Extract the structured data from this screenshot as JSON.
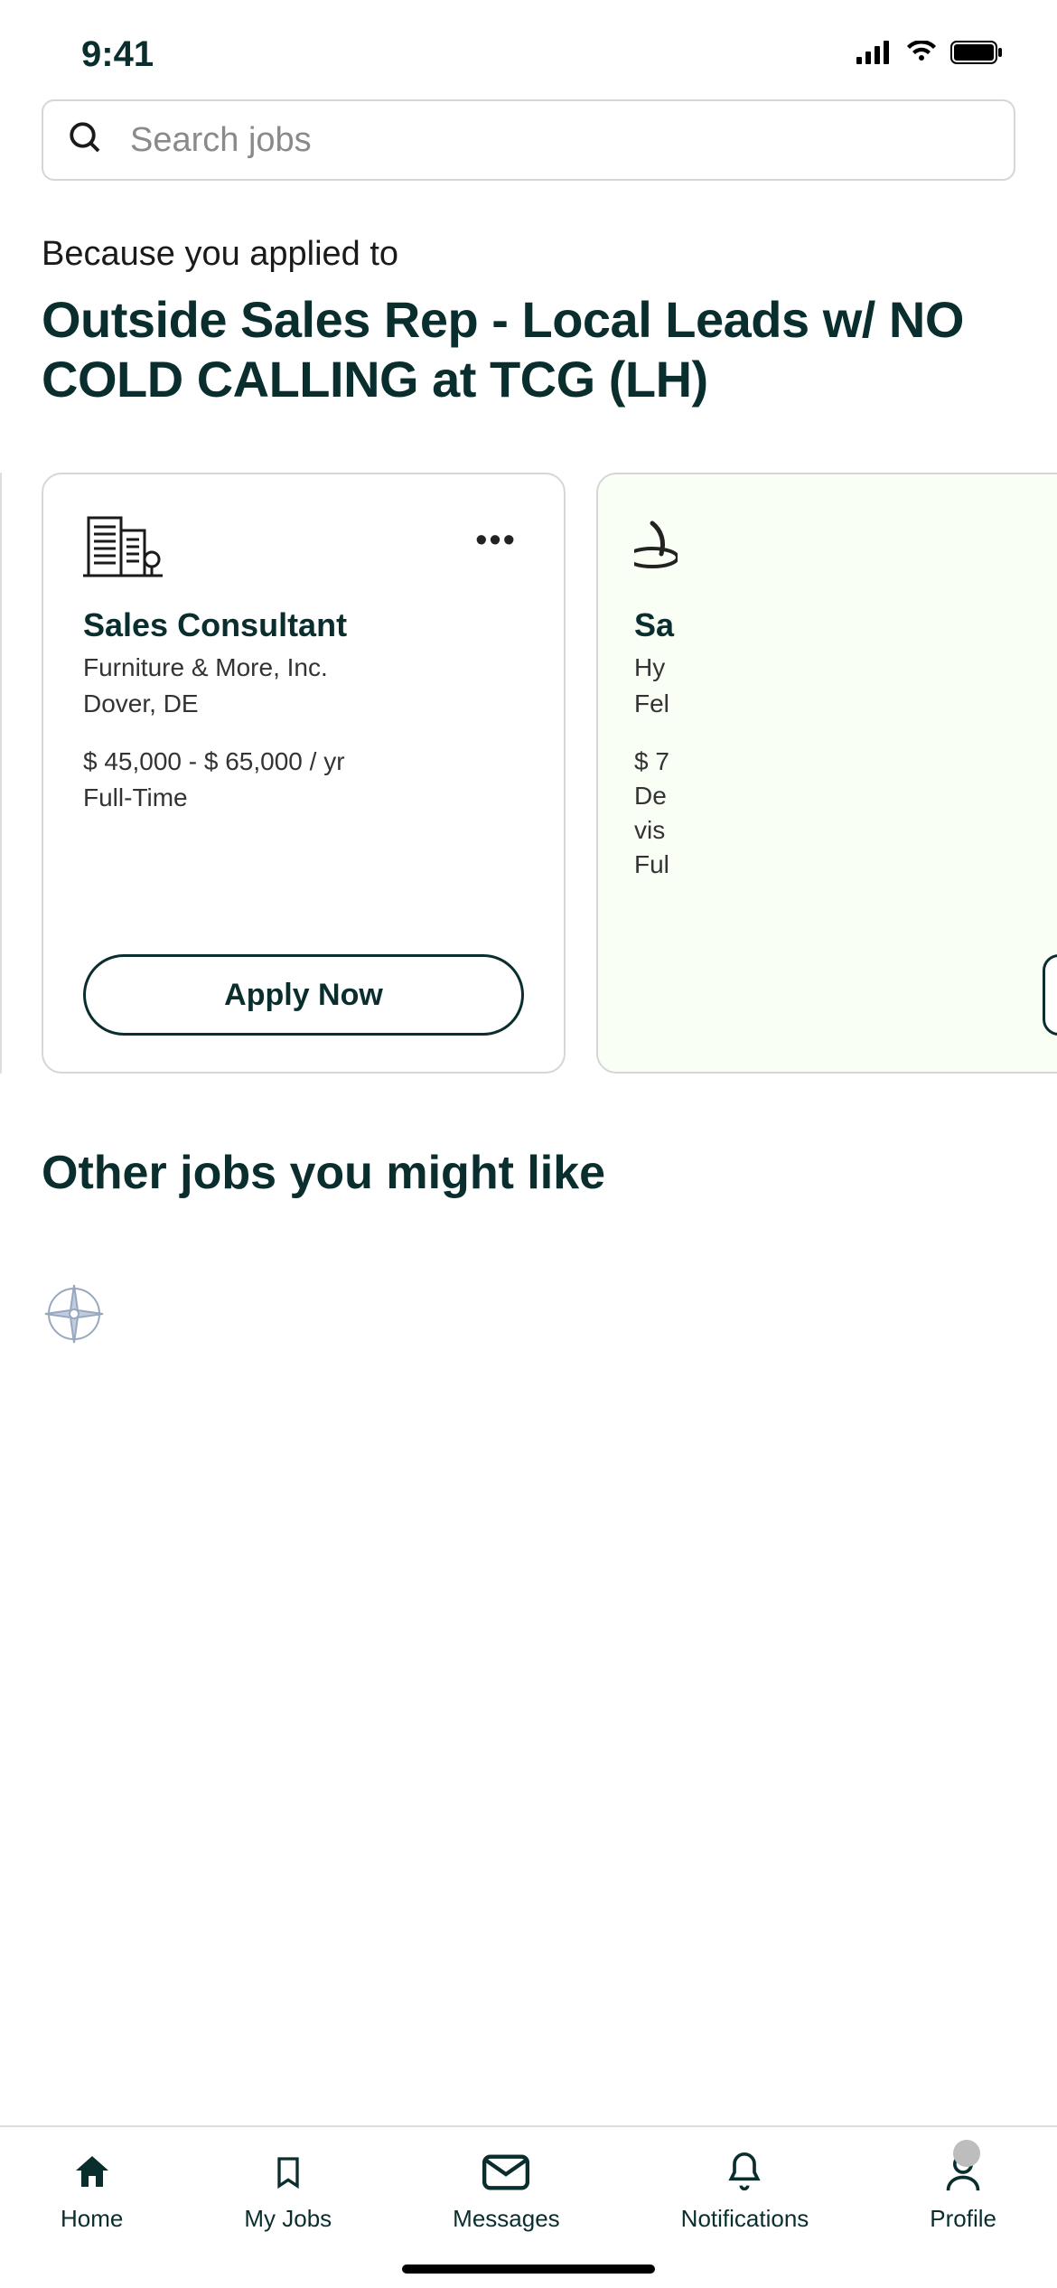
{
  "status": {
    "time": "9:41"
  },
  "search": {
    "placeholder": "Search jobs"
  },
  "recommend": {
    "reason": "Because you applied to",
    "title": "Outside Sales Rep - Local Leads w/ NO COLD CALLING at TCG (LH)"
  },
  "cards": [
    {
      "title": "Sales Consultant",
      "company": "Furniture & More, Inc.",
      "location": "Dover, DE",
      "salary": "$ 45,000 - $ 65,000 / yr",
      "type": "Full-Time",
      "apply_label": "Apply Now"
    },
    {
      "title_partial": "Sa",
      "company_partial": "Hy",
      "location_partial": "Fel",
      "salary_partial": "$ 7",
      "line_a": "De",
      "line_b": "vis",
      "type_partial": "Ful"
    }
  ],
  "other_heading": "Other jobs you might like",
  "nav": {
    "home": "Home",
    "myjobs": "My Jobs",
    "messages": "Messages",
    "notifications": "Notifications",
    "profile": "Profile"
  }
}
